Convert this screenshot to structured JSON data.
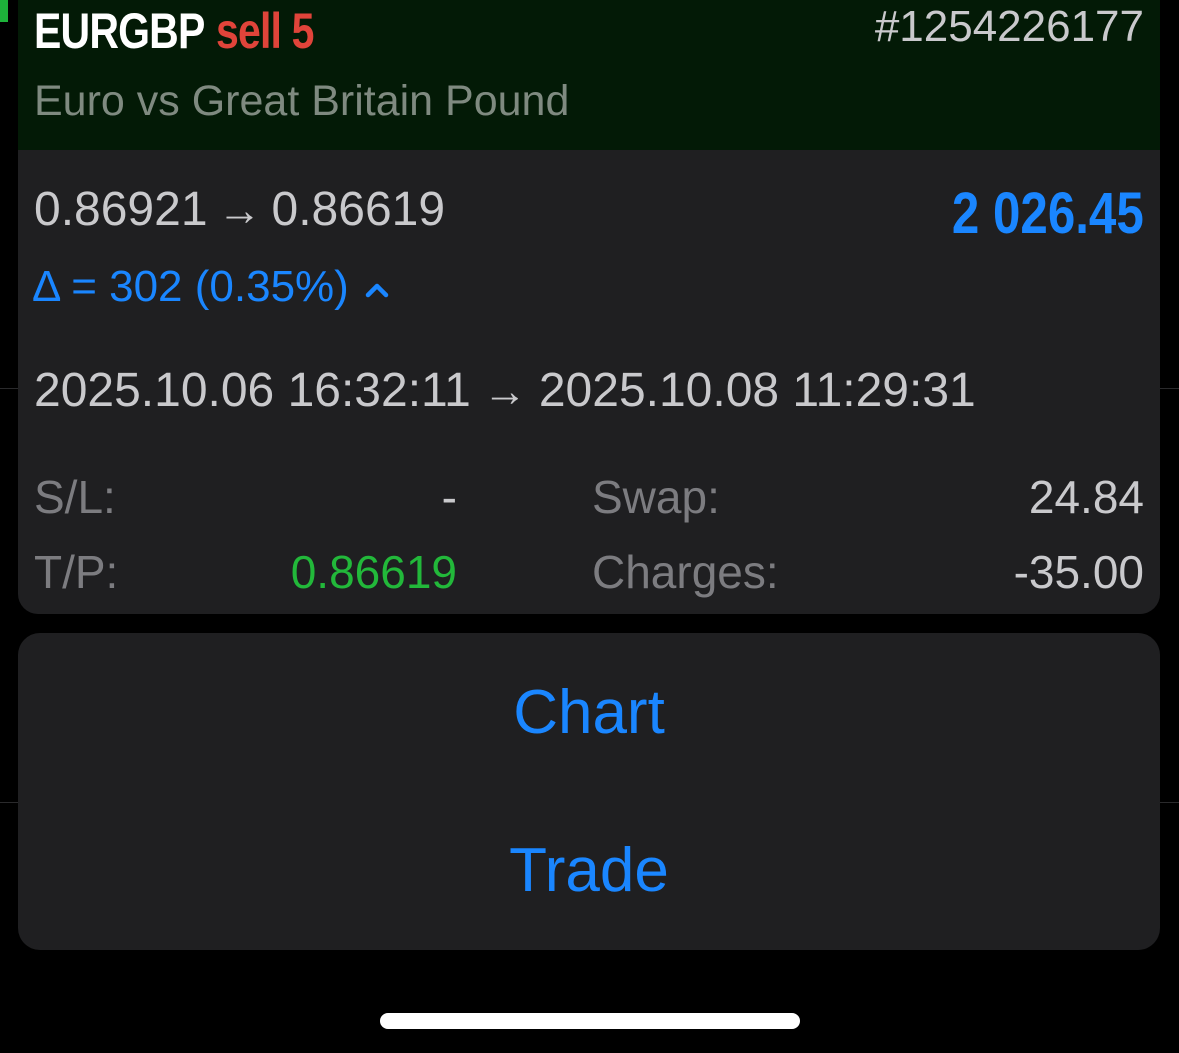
{
  "deal": {
    "symbol": "EURGBP",
    "side_volume": "sell 5",
    "ticket": "#1254226177",
    "description": "Euro vs Great Britain Pound",
    "open_price": "0.86921",
    "close_price": "0.86619",
    "price_arrow": "→",
    "profit": "2 026.45",
    "delta": "Δ = 302 (0.35%)",
    "open_time": "2025.10.06 16:32:11",
    "close_time": "2025.10.08 11:29:31",
    "time_arrow": "→",
    "sl_label": "S/L:",
    "sl_value": "-",
    "tp_label": "T/P:",
    "tp_value": "0.86619",
    "swap_label": "Swap:",
    "swap_value": "24.84",
    "charges_label": "Charges:",
    "charges_value": "-35.00"
  },
  "actions": {
    "chart_label": "Chart",
    "trade_label": "Trade"
  },
  "icons": {
    "delta_toggle": "chevron-up-icon"
  },
  "colors": {
    "accent_blue": "#1a86ff",
    "sell_red": "#e0443a",
    "tp_green": "#22b83a",
    "header_bg": "#031a06",
    "card_bg": "#1f1f21"
  }
}
